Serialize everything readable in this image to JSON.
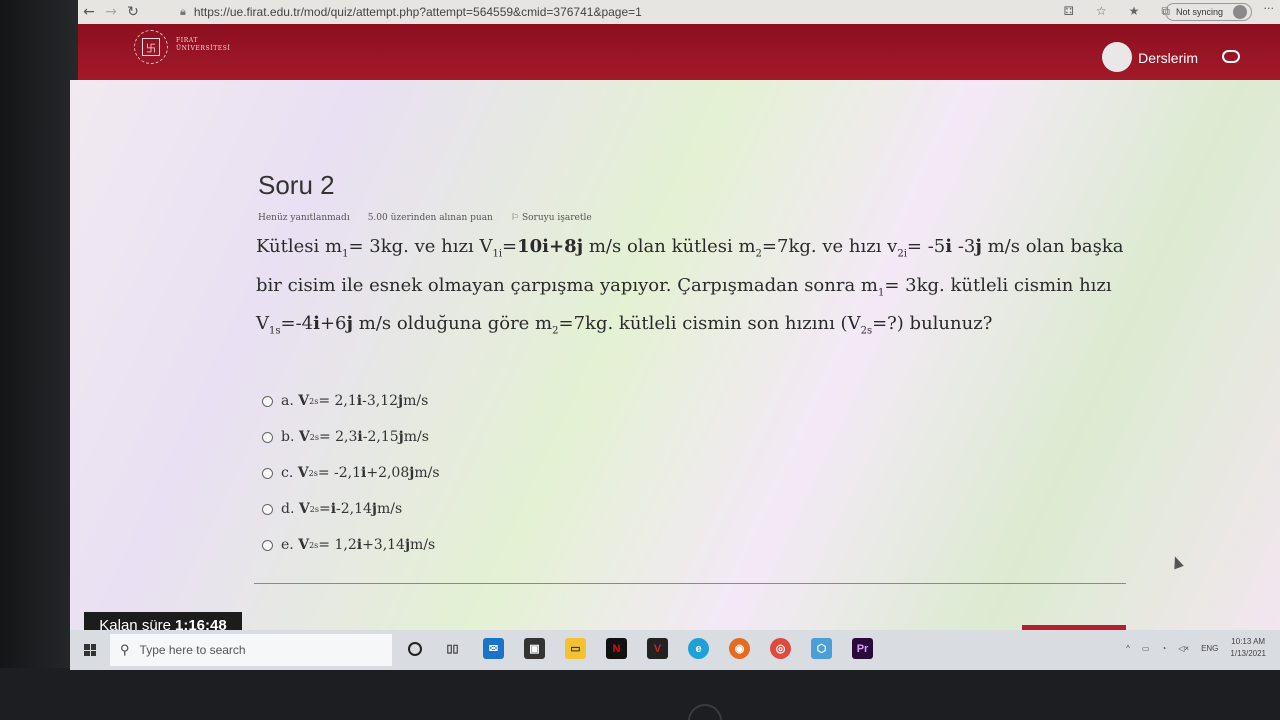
{
  "browser": {
    "url": "https://ue.firat.edu.tr/mod/quiz/attempt.php?attempt=564559&cmid=376741&page=1",
    "sync_label": "Not syncing"
  },
  "header": {
    "logo_text_line1": "FIRAT",
    "logo_text_line2": "ÜNİVERSİTESİ",
    "user_menu": "Derslerim",
    "brand_color": "#9c1627"
  },
  "question": {
    "title": "Soru 2",
    "status": "Henüz yanıtlanmadı",
    "points": "5.00 üzerinden alınan puan",
    "flag_label": "Soruyu işaretle",
    "text": {
      "p1": "Kütlesi",
      "m1": "m",
      "m1_sub": "1",
      "m1_val": "= 3kg.  ve  hızı",
      "v1i": "V",
      "v1i_sub": "1i",
      "v1i_eq": "=",
      "v1i_val": "10i+8j",
      "p2": " m/s  olan kütlesi  m",
      "m2_sub": "2",
      "m2_val": "=7kg.  ve hızı  v",
      "v2i_sub": "2i",
      "v2i_eq": "= -5",
      "v2i_i": "i",
      "v2i_mid": " -3",
      "v2i_j": "j",
      "p3": " m/s  olan başka bir cisim ile esnek olmayan çarpışma yapıyor. Çarpışmadan sonra  m",
      "m1b_sub": "1",
      "p4": "= 3kg. kütleli cismin hızı  V",
      "v1s_sub": "1s",
      "v1s_eq": "=-4",
      "v1s_i": "i",
      "v1s_plus": "+6",
      "v1s_j": "j",
      "p5": " m/s  olduğuna göre  m",
      "m2b_sub": "2",
      "p6": "=7kg.  kütleli cismin son hızını (V",
      "v2s_sub": "2s",
      "p7": "=?) bulunuz?"
    },
    "options": [
      {
        "letter": "a.",
        "v": "V",
        "sub": "2s",
        "pre": "= 2,1",
        "i": "i",
        "mid": " -3,12 ",
        "j": "j",
        "unit": "  m/s"
      },
      {
        "letter": "b.",
        "v": "V",
        "sub": "2s",
        "pre": "= 2,3 ",
        "i": "i",
        "mid": " -2,15",
        "j": "j",
        "unit": "  m/s"
      },
      {
        "letter": "c.",
        "v": "V",
        "sub": "2s",
        "pre": "= -2,1 ",
        "i": "i",
        "mid": " +2,08",
        "j": "j",
        "unit": "  m/s"
      },
      {
        "letter": "d.",
        "v": "V",
        "sub": "2s",
        "pre": "= ",
        "i": "i",
        "mid": " -2,14",
        "j": "j",
        "unit": "  m/s"
      },
      {
        "letter": "e.",
        "v": "V",
        "sub": "2s",
        "pre": "= 1,2 ",
        "i": "i",
        "mid": " +3,14",
        "j": "j",
        "unit": "  m/s"
      }
    ]
  },
  "timer": {
    "label": "Kalan süre",
    "value": "1:16:48"
  },
  "taskbar": {
    "search_placeholder": "Type here to search",
    "tray_lang": "ENG",
    "time": "10:13 AM",
    "date": "1/13/2021"
  }
}
